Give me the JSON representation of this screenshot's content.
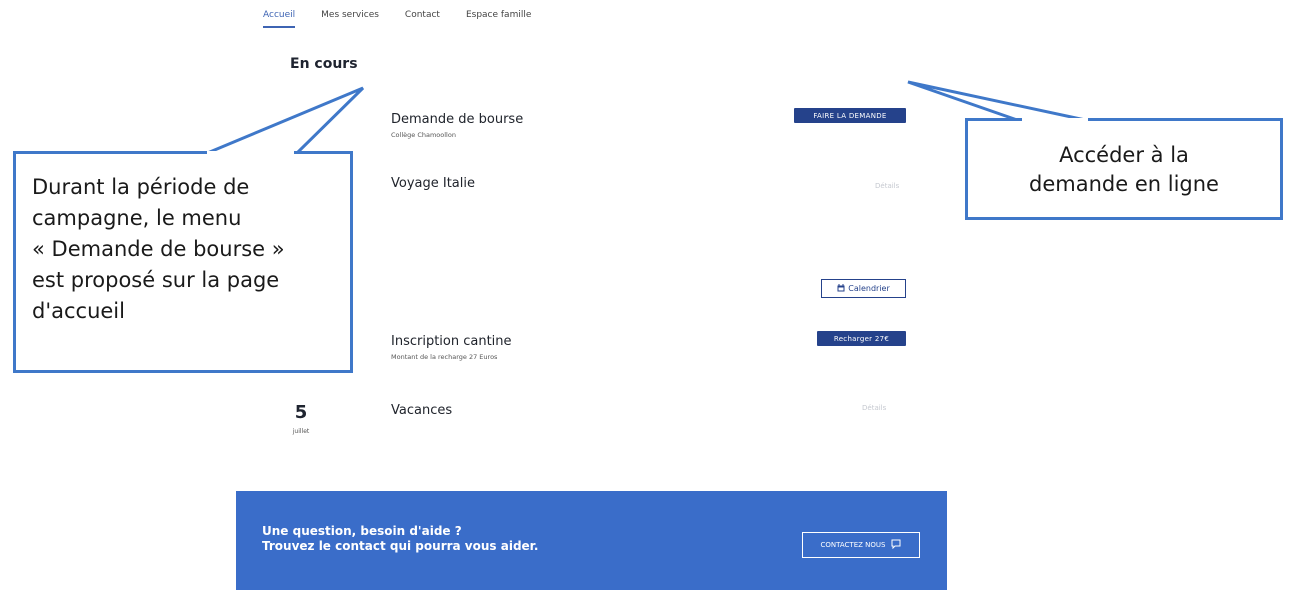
{
  "nav": {
    "tabs": [
      "Accueil",
      "Mes services",
      "Contact",
      "Espace famille"
    ]
  },
  "section_title": "En cours",
  "items": {
    "bourse": {
      "title": "Demande de bourse",
      "subtitle": "Collège Chamoollon",
      "action": "FAIRE LA DEMANDE"
    },
    "italie": {
      "title": "Voyage Italie",
      "action": "Détails"
    },
    "calendrier": {
      "action": "Calendrier"
    },
    "cantine": {
      "title": "Inscription cantine",
      "subtitle": "Montant de la recharge 27 Euros",
      "action": "Recharger 27€"
    },
    "vacances": {
      "title": "Vacances",
      "action": "Détails",
      "day": "5",
      "month": "juillet"
    }
  },
  "help": {
    "line1": "Une question, besoin d'aide ?",
    "line2": "Trouvez le contact qui pourra vous aider.",
    "button": "CONTACTEZ NOUS"
  },
  "callouts": {
    "left": [
      "Durant la période de",
      "campagne, le menu",
      "« Demande de bourse »",
      "est proposé sur la page",
      "d'accueil"
    ],
    "right": [
      "Accéder à la",
      "demande en ligne"
    ]
  },
  "colors": {
    "primary_button": "#25428b",
    "banner": "#3a6dc9",
    "callout_border": "#3f78c9",
    "active_tab": "#3e64b3"
  }
}
